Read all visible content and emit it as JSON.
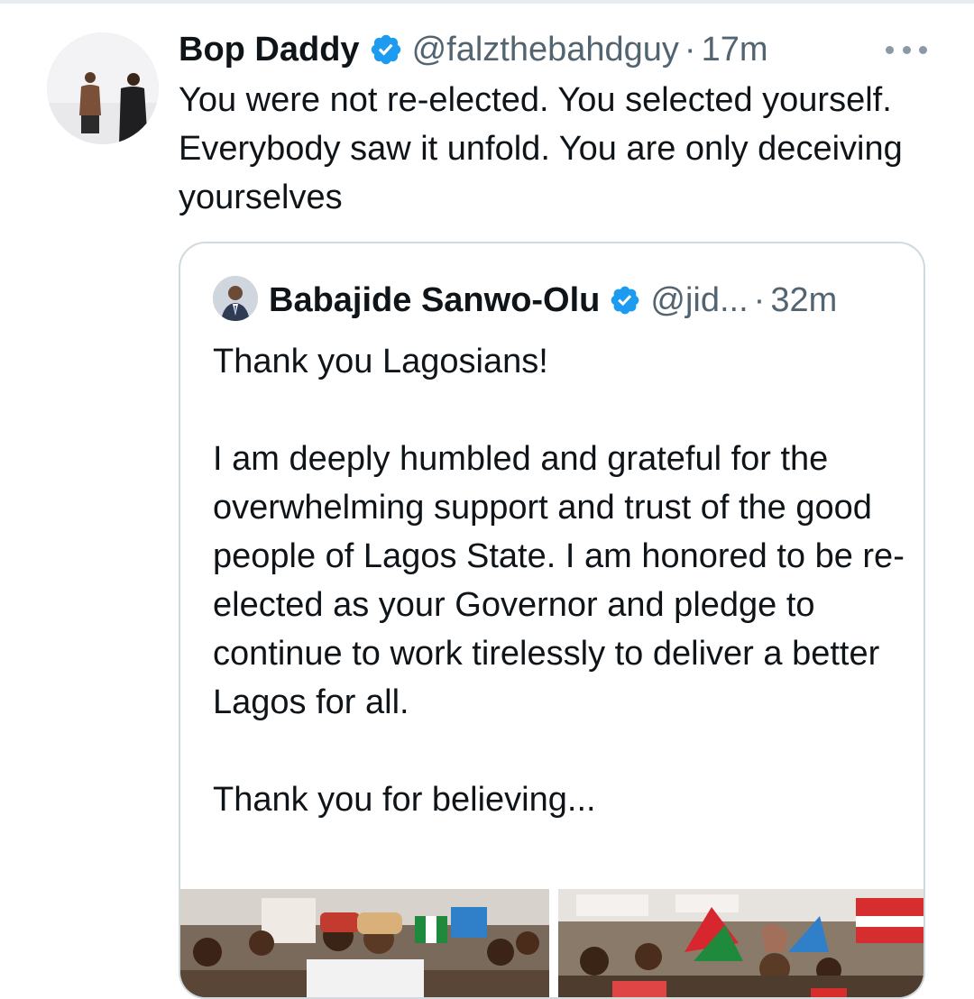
{
  "tweet": {
    "author_name": "Bop Daddy",
    "handle": "@falzthebahdguy",
    "separator": "·",
    "time": "17m",
    "text": "You were not re-elected. You selected yourself. Everybody saw it unfold. You are only deceiving yourselves"
  },
  "quoted_tweet": {
    "author_name": "Babajide Sanwo-Olu",
    "handle": "@jid...",
    "separator": "·",
    "time": "32m",
    "lines": [
      "Thank you Lagosians!",
      "I am deeply humbled and grateful for the overwhelming support and trust of the good people of Lagos State. I am honored to be re-elected as your Governor and pledge to continue to work tirelessly to deliver a better Lagos for all.",
      "Thank you for believing..."
    ]
  },
  "icons": {
    "verified": "verified-badge-icon",
    "more": "more-options-icon"
  },
  "colors": {
    "verified_blue": "#1d9bf0",
    "text_primary": "#0f1419",
    "text_secondary": "#536471",
    "card_border": "#cfd9de"
  }
}
